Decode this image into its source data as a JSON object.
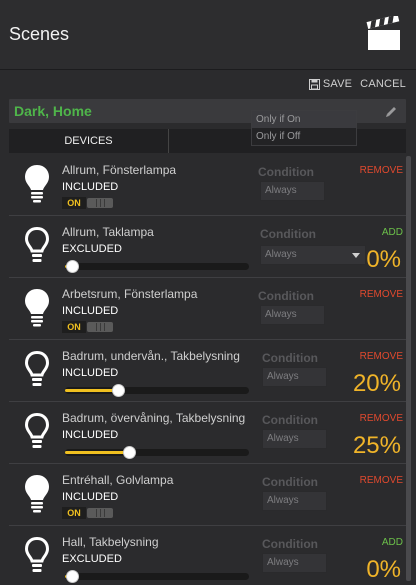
{
  "header": {
    "title": "Scenes",
    "icon": "clapperboard-icon"
  },
  "actions": {
    "save_label": "SAVE",
    "cancel_label": "CANCEL"
  },
  "scene": {
    "name": "Dark, Home"
  },
  "tabs": [
    {
      "label": "DEVICES"
    }
  ],
  "condition_label": "Condition",
  "dropdown": {
    "options": [
      "Only if On",
      "Only if Off"
    ],
    "highlighted": "Only if On"
  },
  "devices": [
    {
      "name": "Allrum, Fönsterlampa",
      "status": "INCLUDED",
      "type": "switch",
      "on_label": "ON",
      "condition": "Always",
      "action": "REMOVE",
      "level_percent": null
    },
    {
      "name": "Allrum, Taklampa",
      "status": "EXCLUDED",
      "type": "dimmer",
      "condition": "Always",
      "action": "ADD",
      "level_percent": 0,
      "pct_label": "0%",
      "dropdown_open": true
    },
    {
      "name": "Arbetsrum, Fönsterlampa",
      "status": "INCLUDED",
      "type": "switch",
      "on_label": "ON",
      "condition": "Always",
      "action": "REMOVE",
      "level_percent": null
    },
    {
      "name": "Badrum, undervån., Takbelysning",
      "status": "INCLUDED",
      "type": "dimmer",
      "condition": "Always",
      "action": "REMOVE",
      "level_percent": 20,
      "pct_label": "20%"
    },
    {
      "name": "Badrum, övervåning, Takbelysning",
      "status": "INCLUDED",
      "type": "dimmer",
      "condition": "Always",
      "action": "REMOVE",
      "level_percent": 25,
      "pct_label": "25%"
    },
    {
      "name": "Entréhall, Golvlampa",
      "status": "INCLUDED",
      "type": "switch",
      "on_label": "ON",
      "condition": "Always",
      "action": "REMOVE",
      "level_percent": null
    },
    {
      "name": "Hall, Takbelysning",
      "status": "EXCLUDED",
      "type": "dimmer",
      "condition": "Always",
      "action": "ADD",
      "level_percent": 0,
      "pct_label": "0%"
    }
  ],
  "colors": {
    "accent": "#f0b429",
    "scene_name": "#4fb54a",
    "remove": "#e0492e",
    "add": "#6cc04a",
    "background": "#2b2b2d"
  }
}
